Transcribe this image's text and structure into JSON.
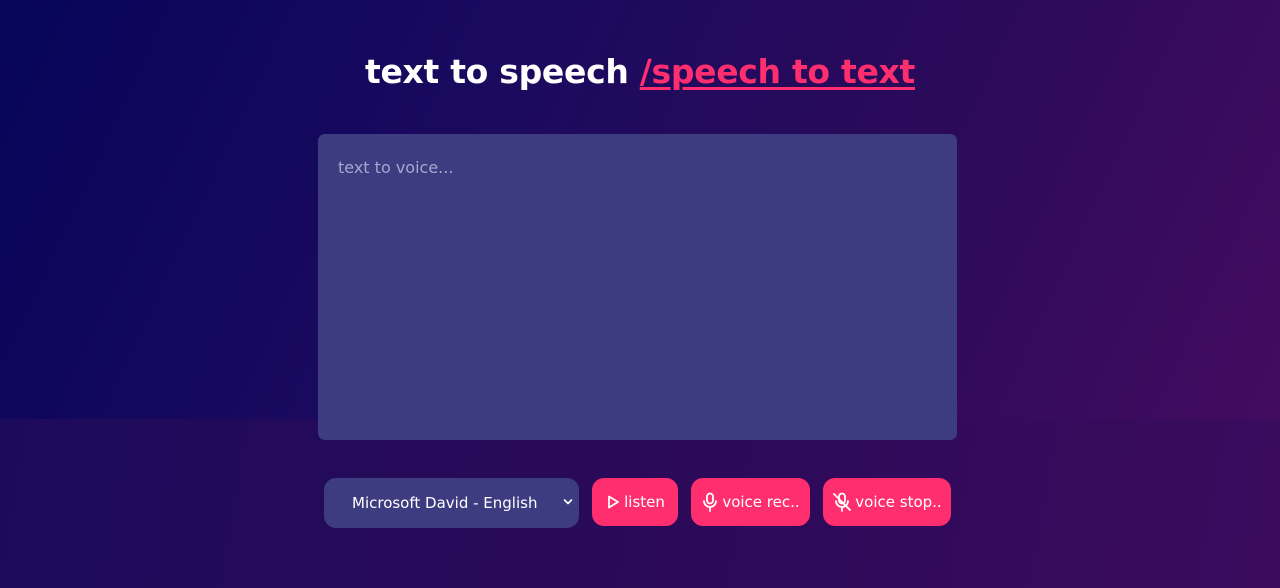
{
  "header": {
    "title_main": "text to speech ",
    "title_link": "/speech to text"
  },
  "editor": {
    "placeholder": "text to voice...",
    "value": ""
  },
  "controls": {
    "voice_select": {
      "selected": "Microsoft David - English (United States)"
    },
    "listen_label": "listen",
    "voice_rec_label": "voice rec..",
    "voice_stop_label": "voice stop.."
  },
  "icons": {
    "listen": "play-icon",
    "voice_rec": "mic-icon",
    "voice_stop": "mic-off-icon",
    "select": "chevron-down-icon"
  },
  "colors": {
    "accent": "#ff2e6e",
    "panel": "#3e3c80",
    "text": "#ffffff"
  }
}
